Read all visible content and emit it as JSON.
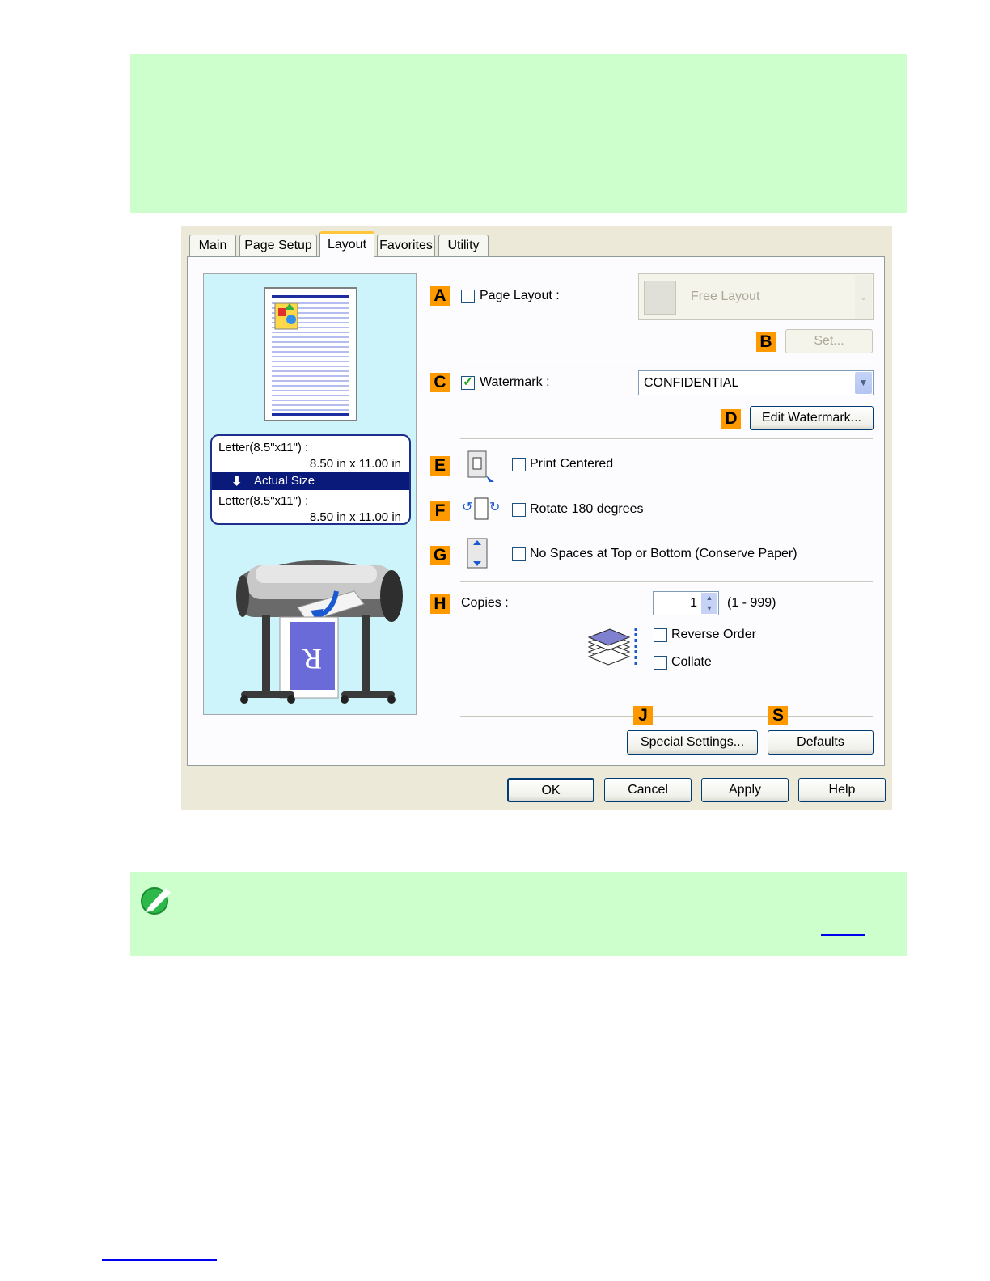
{
  "dialog": {
    "tabs": [
      "Main",
      "Page Setup",
      "Layout",
      "Favorites",
      "Utility"
    ],
    "active_tab": "Layout",
    "preview": {
      "original_size_label": "Letter(8.5\"x11\") :",
      "original_size_value": "8.50 in x 11.00 in",
      "scaling_label": "Actual Size",
      "output_size_label": "Letter(8.5\"x11\") :",
      "output_size_value": "8.50 in x 11.00 in"
    },
    "page_layout": {
      "letter": "A",
      "label": "Page Layout :",
      "checked": false,
      "combo_value": "Free Layout"
    },
    "set_button": {
      "letter": "B",
      "label": "Set..."
    },
    "watermark": {
      "letter": "C",
      "label": "Watermark :",
      "checked": true,
      "combo_value": "CONFIDENTIAL"
    },
    "edit_watermark": {
      "letter": "D",
      "label": "Edit Watermark..."
    },
    "print_centered": {
      "letter": "E",
      "label": "Print Centered",
      "checked": false
    },
    "rotate": {
      "letter": "F",
      "label": "Rotate 180 degrees",
      "checked": false
    },
    "no_spaces": {
      "letter": "G",
      "label": "No Spaces at Top or Bottom (Conserve Paper)",
      "checked": false
    },
    "copies": {
      "letter": "H",
      "label": "Copies :",
      "value": "1",
      "range": "(1 - 999)"
    },
    "reverse_order": {
      "label": "Reverse Order",
      "checked": false
    },
    "collate": {
      "label": "Collate",
      "checked": false
    },
    "special_settings": {
      "letter": "J",
      "label": "Special Settings..."
    },
    "defaults": {
      "letter": "S",
      "label": "Defaults"
    },
    "footer": {
      "ok": "OK",
      "cancel": "Cancel",
      "apply": "Apply",
      "help": "Help"
    }
  },
  "colors": {
    "note_background": "#ccffcc",
    "letter_badge": "#ff9900",
    "preview_background": "#cdf4fb",
    "size_highlight": "#0a1a7a"
  },
  "icons": [
    "note-pencil-icon",
    "printer-icon",
    "page-preview-icon",
    "print-centered-icon",
    "rotate-icon",
    "no-spaces-icon",
    "copies-stack-icon"
  ]
}
